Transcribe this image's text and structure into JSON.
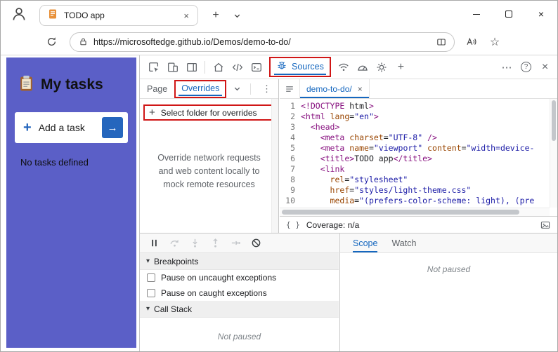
{
  "colors": {
    "accent_blue": "#1567bf",
    "highlight_red": "#d01616",
    "page_purple": "#5b5fc7",
    "task_blue": "#2566bd"
  },
  "icons": {
    "close": "×",
    "plus": "+",
    "arrow_right": "→",
    "star": "☆",
    "more_horizontal": "⋯",
    "more_vertical": "⋮",
    "caret_down": "▾",
    "help": "?",
    "braces": "{ }"
  },
  "titlebar": {
    "tab_title": "TODO app"
  },
  "addressbar": {
    "url": "https://microsoftedge.github.io/Demos/demo-to-do/"
  },
  "page": {
    "title": "My tasks",
    "add_task": "Add a task",
    "empty": "No tasks defined"
  },
  "devtools": {
    "toolbar": {
      "sources_label": "Sources"
    },
    "sidebar": {
      "tab_page": "Page",
      "tab_overrides": "Overrides",
      "select_folder": "Select folder for overrides",
      "description": "Override network requests and web content locally to mock remote resources"
    },
    "editor": {
      "file_tab": "demo-to-do/",
      "coverage": "Coverage: n/a",
      "lines": [
        "<!DOCTYPE html>",
        "<html lang=\"en\">",
        "  <head>",
        "    <meta charset=\"UTF-8\" />",
        "    <meta name=\"viewport\" content=\"width=device-",
        "    <title>TODO app</title>",
        "    <link",
        "      rel=\"stylesheet\"",
        "      href=\"styles/light-theme.css\"",
        "      media=\"(prefers-color-scheme: light), (pre"
      ]
    },
    "debugger": {
      "breakpoints": "Breakpoints",
      "checkboxes": [
        "Pause on uncaught exceptions",
        "Pause on caught exceptions"
      ],
      "call_stack": "Call Stack",
      "not_paused": "Not paused",
      "tab_scope": "Scope",
      "tab_watch": "Watch"
    }
  }
}
